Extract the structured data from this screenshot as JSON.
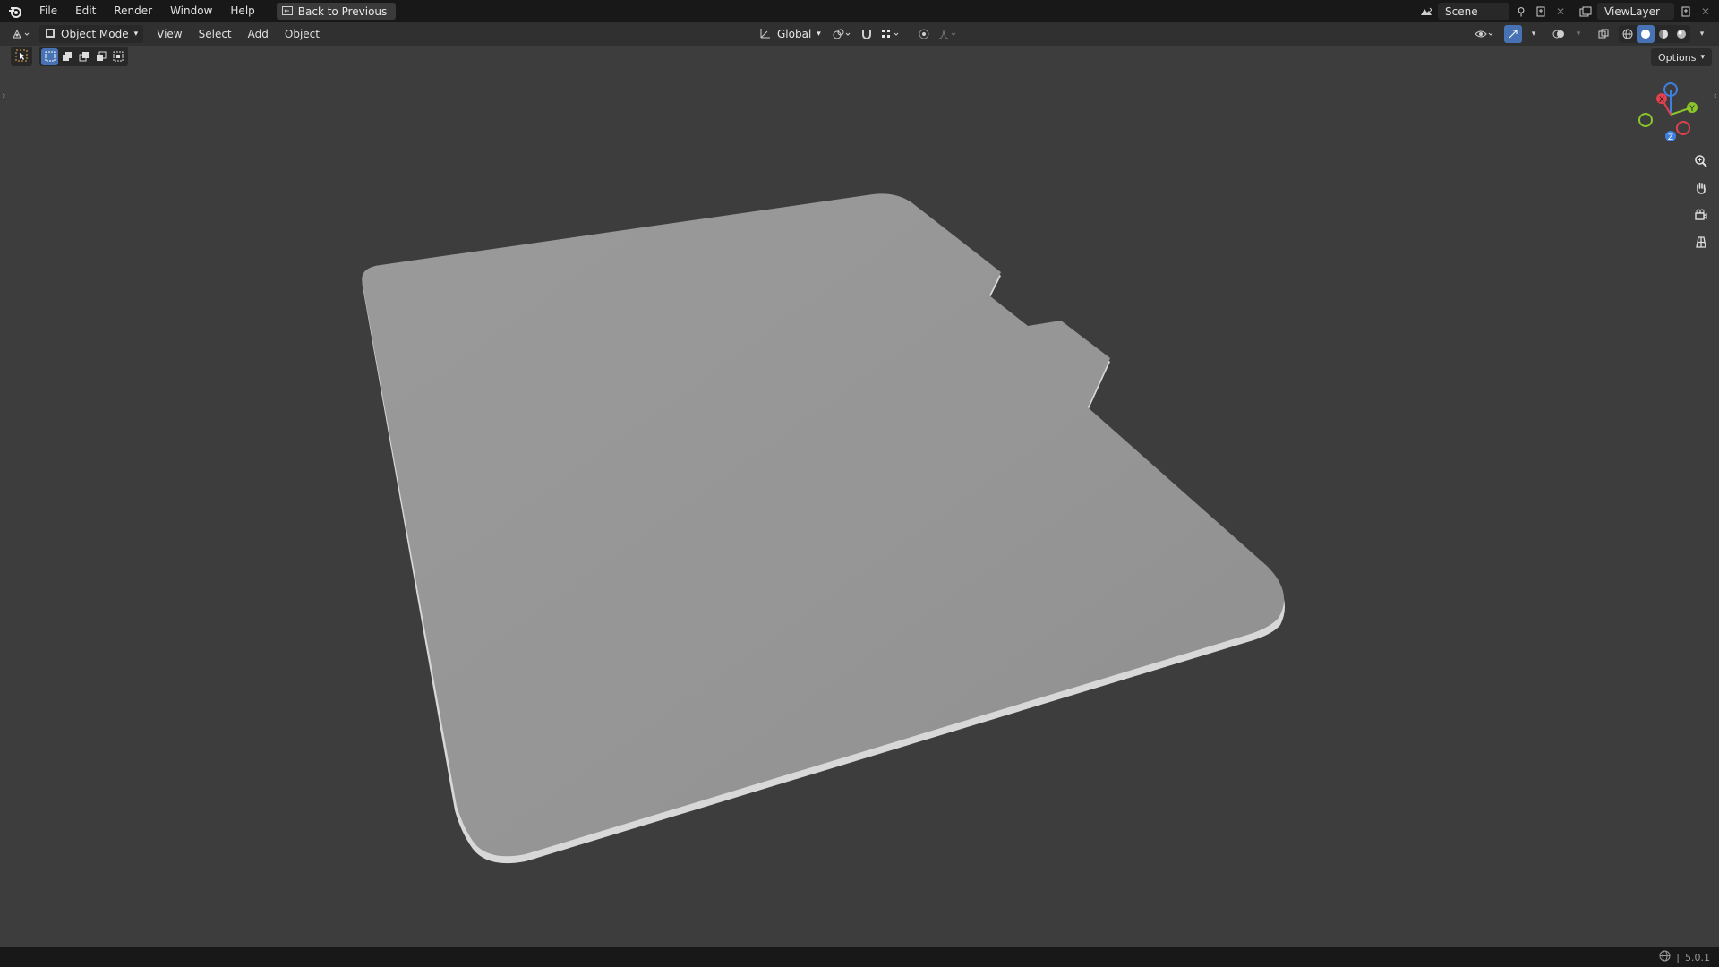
{
  "topbar": {
    "menus": [
      "File",
      "Edit",
      "Render",
      "Window",
      "Help"
    ],
    "back_label": "Back to Previous",
    "scene": "Scene",
    "view_layer": "ViewLayer"
  },
  "header": {
    "mode": "Object Mode",
    "menus": [
      "View",
      "Select",
      "Add",
      "Object"
    ],
    "transform_orientation": "Global"
  },
  "options_label": "Options",
  "gizmo": {
    "x": "X",
    "y": "Y",
    "z": "Z"
  },
  "status": {
    "version": "5.0.1"
  },
  "colors": {
    "viewport_bg": "#3d3d3d",
    "topbar_bg": "#181818",
    "header_bg": "#303030",
    "accent": "#4772b3",
    "axis_x": "#e2404f",
    "axis_y": "#8ac52b",
    "axis_z": "#3f7fe0",
    "mesh": "#979797"
  },
  "icons": [
    "blender-logo-icon",
    "back-icon",
    "scene-icon",
    "pin-icon",
    "new-scene-icon",
    "close-icon",
    "viewlayer-icon",
    "editor-type-icon",
    "object-mode-icon",
    "transform-orientation-icon",
    "pivot-icon",
    "snap-icon",
    "proportional-icon",
    "visibility-icon",
    "gizmo-icon",
    "overlay-icon",
    "xray-icon",
    "wireframe-icon",
    "solid-icon",
    "material-icon",
    "rendered-icon",
    "zoom-icon",
    "hand-pan-icon",
    "camera-icon",
    "grid-view-icon",
    "select-box-icon",
    "globe-icon"
  ]
}
